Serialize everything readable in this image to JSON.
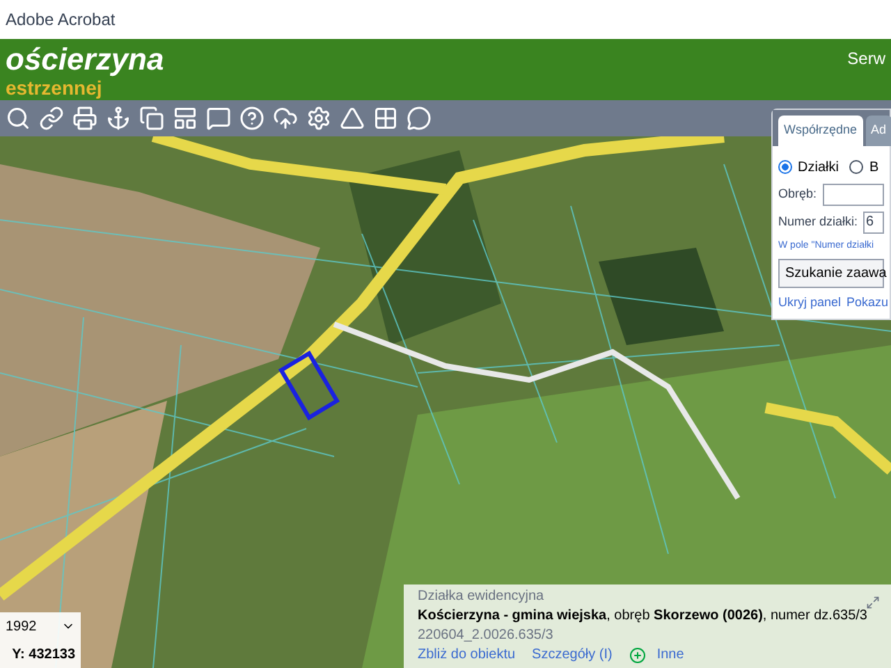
{
  "window": {
    "title": "Adobe Acrobat"
  },
  "header": {
    "title": "ościerzyna",
    "subtitle": "estrzennej",
    "link": "Serw"
  },
  "search_panel": {
    "tabs": [
      {
        "label": "Współrzędne",
        "selected": true
      },
      {
        "label": "Ad",
        "selected": false
      }
    ],
    "modes": [
      {
        "label": "Działki",
        "selected": true
      },
      {
        "label": "B",
        "selected": false
      }
    ],
    "fields": [
      {
        "label": "Obręb:"
      },
      {
        "label": "Numer działki:",
        "value": "6"
      }
    ],
    "hint": "W pole \"Numer działki",
    "button": "Szukanie zaawa",
    "links": [
      "Ukryj panel",
      "Pokazu"
    ]
  },
  "coords": {
    "system": "1992",
    "y": "Y: 432133"
  },
  "info_popup": {
    "heading": "Działka ewidencyjna",
    "description": "**Kościerzyna - gmina wiejska**, obręb **Skorzewo (0026)**, numer dz.635/3",
    "id": "220604_2.0026.635/3",
    "links": [
      "Zbliż do obiektu",
      "Szczegóły (I)"
    ],
    "more": "Inne"
  }
}
